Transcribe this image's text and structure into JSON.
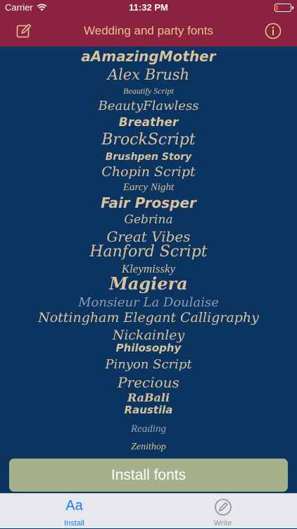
{
  "status_bar": {
    "carrier": "Carrier",
    "time": "11:32 PM",
    "battery_level": 0.15,
    "battery_color": "#ff3b30"
  },
  "nav": {
    "title": "Wedding and party fonts",
    "left_icon": "compose-icon",
    "right_icon": "info-icon",
    "accent_color": "#e9c491",
    "bar_color": "#8b2340"
  },
  "fonts": [
    "aAmazingMother",
    "Alex Brush",
    "Beautify Script",
    "BeautyFlawless",
    "Breather",
    "BrockScript",
    "Brushpen Story",
    "Chopin Script",
    "Earcy Night",
    "Fair Prosper",
    "Gebrina",
    "Great Vibes",
    "Hanford Script",
    "Kleymissky",
    "Magiera",
    "Monsieur La Doulaise",
    "Nottingham Elegant Calligraphy",
    "Nickainley",
    "Philosophy",
    "Pinyon Script",
    "Precious",
    "RaBali",
    "Raustila",
    "Reading",
    "Zenithop"
  ],
  "install_button": {
    "label": "Install fonts",
    "color": "#a4b18b"
  },
  "tabs": [
    {
      "label": "Install",
      "icon": "Aa",
      "selected": true
    },
    {
      "label": "Write",
      "icon": "pen-icon",
      "selected": false
    }
  ]
}
